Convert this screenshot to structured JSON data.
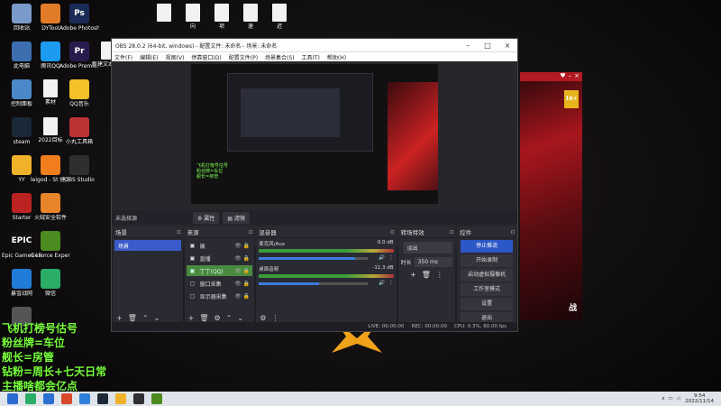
{
  "desktop_icons": [
    {
      "label": "回收站",
      "color": "#7a9ac9"
    },
    {
      "label": "DYTool",
      "color": "#e27b28"
    },
    {
      "label": "Adobe Photosh...",
      "color": "#1a2b55",
      "glyph": "Ps"
    },
    {
      "label": "",
      "color": "doc"
    },
    {
      "label": "向",
      "color": "doc"
    },
    {
      "label": "项",
      "color": "doc"
    },
    {
      "label": "速",
      "color": "doc"
    },
    {
      "label": "迟",
      "color": "doc"
    },
    {
      "label": "此电脑",
      "color": "#3d6fb0"
    },
    {
      "label": "腾讯QQ",
      "color": "#1d9bf0"
    },
    {
      "label": "Adobe Premie...",
      "color": "#2a1b4f",
      "glyph": "Pr"
    },
    {
      "label": "新建文本文档",
      "color": "doc"
    },
    {
      "label": "控制面板",
      "color": "#4a88c7"
    },
    {
      "label": "素材",
      "color": "doc"
    },
    {
      "label": "QQ音乐",
      "color": "#f5c02a"
    },
    {
      "label": "steam",
      "color": "#1b2838"
    },
    {
      "label": "2022目标",
      "color": "doc"
    },
    {
      "label": "小丸工具箱",
      "color": "#b33"
    },
    {
      "label": "YY",
      "color": "#f0b22a"
    },
    {
      "label": "leigod - St 捷方式",
      "color": "#f07d1e"
    },
    {
      "label": "OBS Studio",
      "color": "#302e31"
    },
    {
      "label": "Starter",
      "color": "#b22"
    },
    {
      "label": "火绒安全软件",
      "color": "#e8842a"
    },
    {
      "label": "Epic Games Launcher",
      "color": "#111",
      "glyph": "EPIC"
    },
    {
      "label": "GeForce Experience",
      "color": "#4b8b1f"
    },
    {
      "label": "暴雪战网",
      "color": "#1f7dd8"
    },
    {
      "label": "微信",
      "color": "#2aae67"
    },
    {
      "label": "",
      "color": "#555"
    }
  ],
  "obs": {
    "title": "OBS 28.0.2 (64-bit, windows) - 配置文件: 未命名 - 场景: 未命名",
    "menu": [
      "文件(F)",
      "编辑(E)",
      "视图(V)",
      "停靠窗口(D)",
      "配置文件(P)",
      "场景集合(S)",
      "工具(T)",
      "帮助(H)"
    ],
    "no_source": "未选择源",
    "properties": "属性",
    "filters": "滤镜",
    "scenes_title": "场景",
    "scenes": [
      "场景"
    ],
    "sources_title": "来源",
    "sources": [
      {
        "name": "展",
        "icon": "▣"
      },
      {
        "name": "直播",
        "icon": "▣"
      },
      {
        "name": "丁丁(QQ)",
        "icon": "▣"
      },
      {
        "name": "窗口采集",
        "icon": "▢"
      },
      {
        "name": "显示器采集",
        "icon": "▢"
      }
    ],
    "mixer_title": "混音器",
    "mixer": [
      {
        "name": "麦克风/Aux",
        "db": "0.0 dB",
        "level": 0.88
      },
      {
        "name": "桌面音频",
        "db": "-11.3 dB",
        "level": 0.55
      }
    ],
    "transitions_title": "转场特效",
    "transition": "淡出",
    "duration_label": "时长",
    "duration": "350 ms",
    "controls_title": "控件",
    "controls": [
      "停止推流",
      "开始录制",
      "启动虚拟摄像机",
      "工作室模式",
      "设置",
      "退出"
    ],
    "status": {
      "live": "LIVE: 00:00:00",
      "rec": "REC: 00:00:00",
      "cpu": "CPU: 0.3%, 60.00 fps"
    }
  },
  "right_window": {
    "badge": "16+",
    "logo": "战"
  },
  "overlay_lines": [
    "飞机打榜号估号",
    "粉丝牌=车位",
    "舰长=房管",
    "钻粉=周长+七天日常",
    "主播啥都会亿点"
  ],
  "taskbar": {
    "time": "9:54",
    "date": "2022/11/14"
  }
}
